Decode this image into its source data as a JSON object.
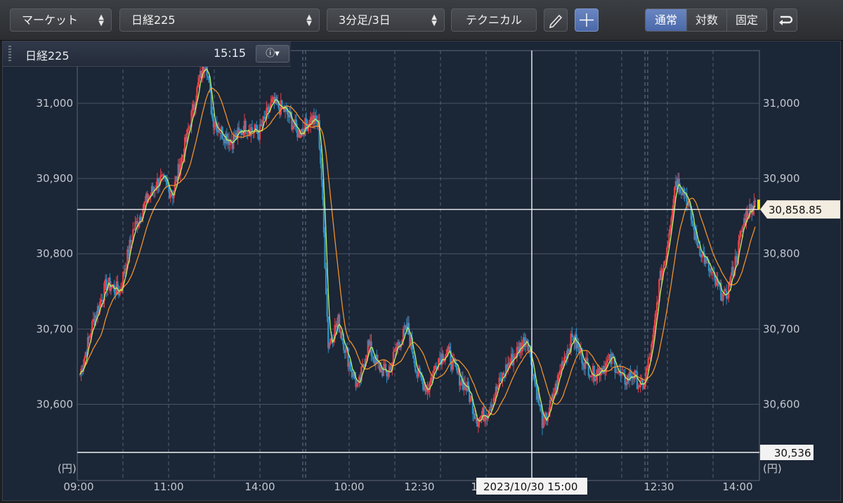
{
  "toolbar": {
    "market_select": "マーケット",
    "symbol_select": "日経225",
    "period_select": "3分足/3日",
    "technical_button": "テクニカル",
    "scale_modes": [
      "通常",
      "対数",
      "固定"
    ],
    "active_scale_mode": "通常"
  },
  "info_bar": {
    "symbol": "日経225",
    "time": "15:15"
  },
  "colors": {
    "up_candle": "#e8414a",
    "down_candle": "#2f8fc4",
    "ma_short": "#b7ef6a",
    "ma_long": "#f0912c",
    "background": "#1b2636"
  },
  "chart_data": {
    "type": "candlestick",
    "unit_label": "(円)",
    "ylim": [
      30536,
      31070
    ],
    "yticks": [
      30600,
      30700,
      30800,
      30900,
      31000
    ],
    "ytick_labels": [
      "30,600",
      "30,700",
      "30,800",
      "30,900",
      "31,000"
    ],
    "xtick_labels": [
      "09:00",
      "11:00",
      "14:00",
      "10:00",
      "12:30",
      "14:00",
      "12:30",
      "14:00"
    ],
    "crosshair_price": 30858.85,
    "crosshair_price_label": "30,858.85",
    "crosshair_time_label": "2023/10/30 15:00",
    "low_line_value": 30536,
    "low_line_label": "30,536",
    "series": [
      {
        "name": "short moving average",
        "color": "#b7ef6a"
      },
      {
        "name": "long moving average",
        "color": "#f0912c"
      }
    ],
    "anchors": [
      [
        0,
        30640
      ],
      [
        4,
        30710
      ],
      [
        8,
        30760
      ],
      [
        12,
        30750
      ],
      [
        16,
        30830
      ],
      [
        20,
        30870
      ],
      [
        24,
        30900
      ],
      [
        28,
        30880
      ],
      [
        32,
        30950
      ],
      [
        36,
        31030
      ],
      [
        38,
        31060
      ],
      [
        40,
        30980
      ],
      [
        43,
        30960
      ],
      [
        46,
        30950
      ],
      [
        50,
        30970
      ],
      [
        54,
        30960
      ],
      [
        58,
        31000
      ],
      [
        62,
        30990
      ],
      [
        66,
        30960
      ],
      [
        70,
        30980
      ],
      [
        72,
        30970
      ],
      [
        73,
        30900
      ],
      [
        75,
        30680
      ],
      [
        78,
        30710
      ],
      [
        81,
        30660
      ],
      [
        84,
        30620
      ],
      [
        87,
        30680
      ],
      [
        90,
        30650
      ],
      [
        93,
        30640
      ],
      [
        96,
        30680
      ],
      [
        99,
        30700
      ],
      [
        102,
        30640
      ],
      [
        105,
        30620
      ],
      [
        108,
        30660
      ],
      [
        111,
        30670
      ],
      [
        114,
        30640
      ],
      [
        117,
        30620
      ],
      [
        120,
        30580
      ],
      [
        123,
        30590
      ],
      [
        126,
        30620
      ],
      [
        129,
        30650
      ],
      [
        132,
        30670
      ],
      [
        135,
        30690
      ],
      [
        137,
        30640
      ],
      [
        140,
        30570
      ],
      [
        143,
        30610
      ],
      [
        146,
        30660
      ],
      [
        149,
        30690
      ],
      [
        152,
        30660
      ],
      [
        155,
        30640
      ],
      [
        158,
        30650
      ],
      [
        161,
        30660
      ],
      [
        164,
        30630
      ],
      [
        167,
        30640
      ],
      [
        170,
        30620
      ],
      [
        173,
        30680
      ],
      [
        175,
        30760
      ],
      [
        177,
        30800
      ],
      [
        180,
        30900
      ],
      [
        183,
        30880
      ],
      [
        186,
        30820
      ],
      [
        189,
        30790
      ],
      [
        192,
        30760
      ],
      [
        195,
        30740
      ],
      [
        198,
        30790
      ],
      [
        201,
        30850
      ],
      [
        204,
        30870
      ]
    ]
  }
}
